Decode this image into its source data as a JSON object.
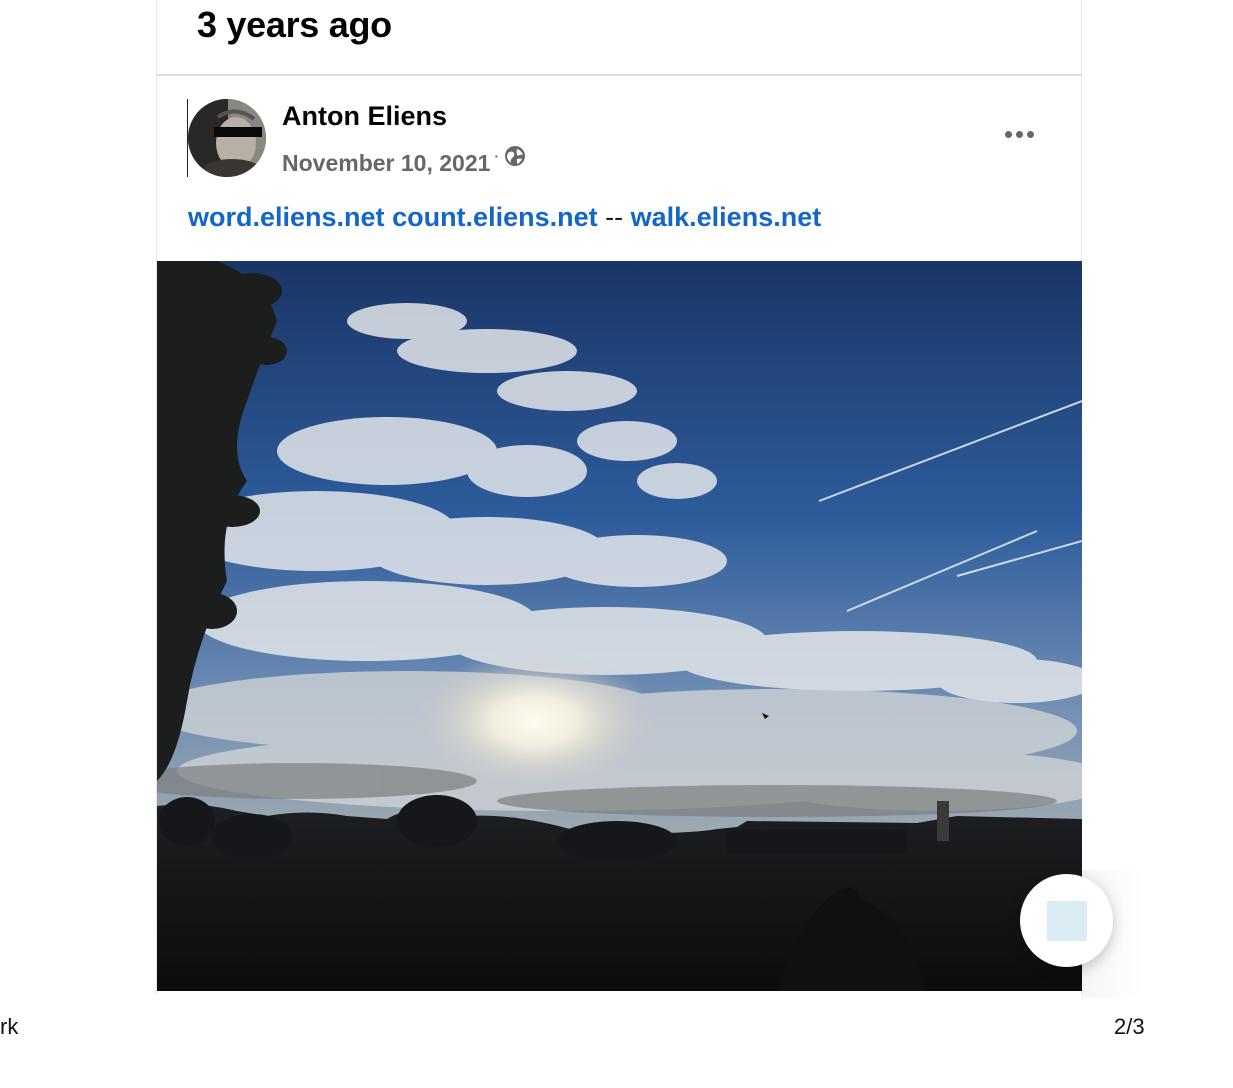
{
  "memory": {
    "title": "3 years ago"
  },
  "post": {
    "author": "Anton Eliens",
    "date": "November 10, 2021",
    "dot": "·",
    "privacy_icon": "globe-icon",
    "more_icon": "more-horizontal-icon",
    "links": {
      "word": "word.eliens.net",
      "count": "count.eliens.net",
      "separator": "--",
      "walk": "walk.eliens.net"
    }
  },
  "fab": {
    "icon": "square-icon"
  },
  "footer": {
    "left": "rk",
    "page": "2/3"
  },
  "colors": {
    "link": "#1466c8",
    "meta": "#65676b",
    "sky": "#1c3e78"
  }
}
